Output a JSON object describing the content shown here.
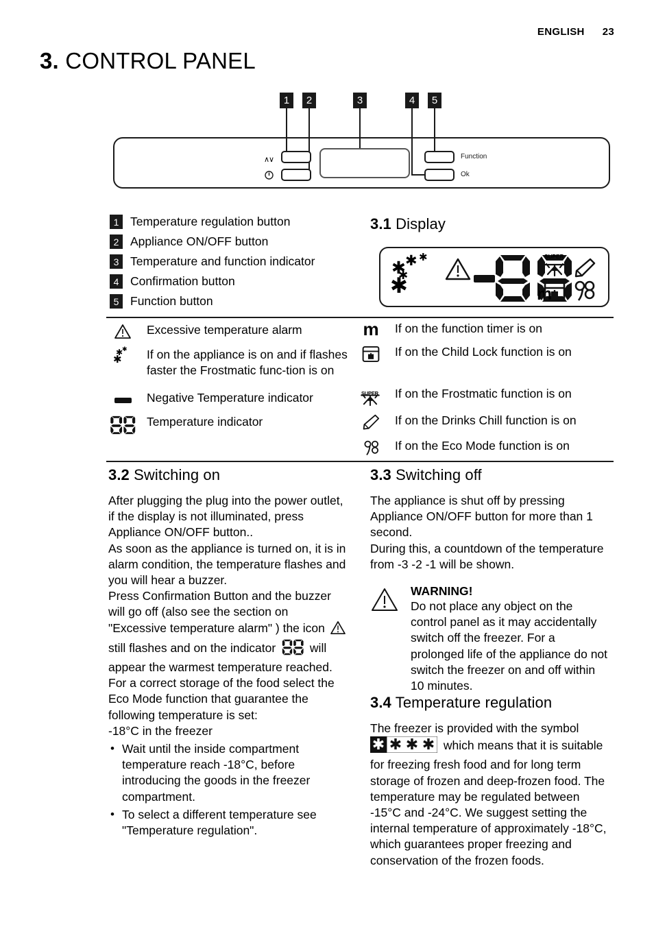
{
  "header": {
    "language": "ENGLISH",
    "page_number": "23"
  },
  "title": {
    "number": "3.",
    "name": "CONTROL PANEL"
  },
  "panel_figure": {
    "callouts": [
      "1",
      "2",
      "3",
      "4",
      "5"
    ],
    "left_symbols": {
      "updown": "∧∨",
      "power": "power-icon"
    },
    "right_labels": {
      "function": "Function",
      "ok": "Ok"
    }
  },
  "legend": [
    {
      "num": "1",
      "label": "Temperature regulation button"
    },
    {
      "num": "2",
      "label": "Appliance ON/OFF button"
    },
    {
      "num": "3",
      "label": "Temperature and function indicator"
    },
    {
      "num": "4",
      "label": "Confirmation button"
    },
    {
      "num": "5",
      "label": "Function button"
    }
  ],
  "display_section": {
    "number": "3.1",
    "name": "Display",
    "icons": [
      "snowflakes-icon",
      "warning-triangle-icon",
      "minus-icon",
      "seven-segment-88",
      "m-icon",
      "super-frostmatic-icon",
      "bottle-drinks-chill-icon",
      "child-lock-icon",
      "eco-mode-fan-icon"
    ]
  },
  "icon_legend_left": [
    {
      "icon": "warning-triangle-icon",
      "text": "Excessive temperature alarm"
    },
    {
      "icon": "snowflakes-icon",
      "text": "If on the appliance is on and if flashes faster the Frostmatic func-tion is on"
    },
    {
      "icon": "minus-icon",
      "text": "Negative Temperature indicator"
    },
    {
      "icon": "seven-segment-88",
      "text": "Temperature indicator"
    }
  ],
  "icon_legend_right": [
    {
      "icon": "m-icon",
      "text": "If on the function timer is on"
    },
    {
      "icon": "child-lock-icon",
      "text": "If on the Child Lock function is on"
    },
    {
      "icon": "super-frostmatic-icon",
      "text": "If on the Frostmatic function is on"
    },
    {
      "icon": "bottle-drinks-chill-icon",
      "text": "If on the Drinks Chill function is on"
    },
    {
      "icon": "eco-mode-fan-icon",
      "text": "If on the Eco Mode function is on"
    }
  ],
  "switching_on": {
    "number": "3.2",
    "name": "Switching on",
    "p1": "After plugging the plug into the power outlet, if the display is not illuminated, press Appliance ON/OFF button..",
    "p2": "As soon as the appliance is turned on, it is in alarm condition, the temperature flashes and you will hear a buzzer.",
    "p3_a": "Press Confirmation Button and the buzzer will go off (also see the section on \"Excessive temperature alarm\" ) the icon",
    "p3_b": "still flashes and on the indicator",
    "p3_c": "will appear the warmest temperature reached.",
    "p4": "For a correct storage of the food select the Eco Mode function that guarantee the following temperature is set:",
    "p5": "-18°C in the freezer",
    "bullets": [
      "Wait until the inside compartment temperature reach -18°C, before introducing the goods in the freezer compartment.",
      "To select a different temperature see \"Temperature regulation\"."
    ]
  },
  "switching_off": {
    "number": "3.3",
    "name": "Switching off",
    "p1": "The appliance is shut off by pressing Appliance ON/OFF button for more than 1 second.",
    "p2": "During this, a countdown of the temperature from -3 -2 -1 will be shown.",
    "warning_title": "WARNING!",
    "warning_body": "Do not place any object on the control panel as it may accidentally switch off the freezer. For a prolonged life of the appliance do not switch the freezer on and off within 10 minutes."
  },
  "temperature_regulation": {
    "number": "3.4",
    "name": "Temperature regulation",
    "p1_a": "The freezer is provided with the symbol",
    "p1_b": "which means that it is suitable for freezing fresh food and for long term storage of frozen and deep-frozen food. The temperature may be regulated between -15°C and -24°C. We suggest setting the internal temperature of approximately -18°C, which guarantees proper freezing and conservation of the frozen foods."
  },
  "colors": {
    "ink": "#1a1a1a",
    "paper": "#ffffff"
  }
}
